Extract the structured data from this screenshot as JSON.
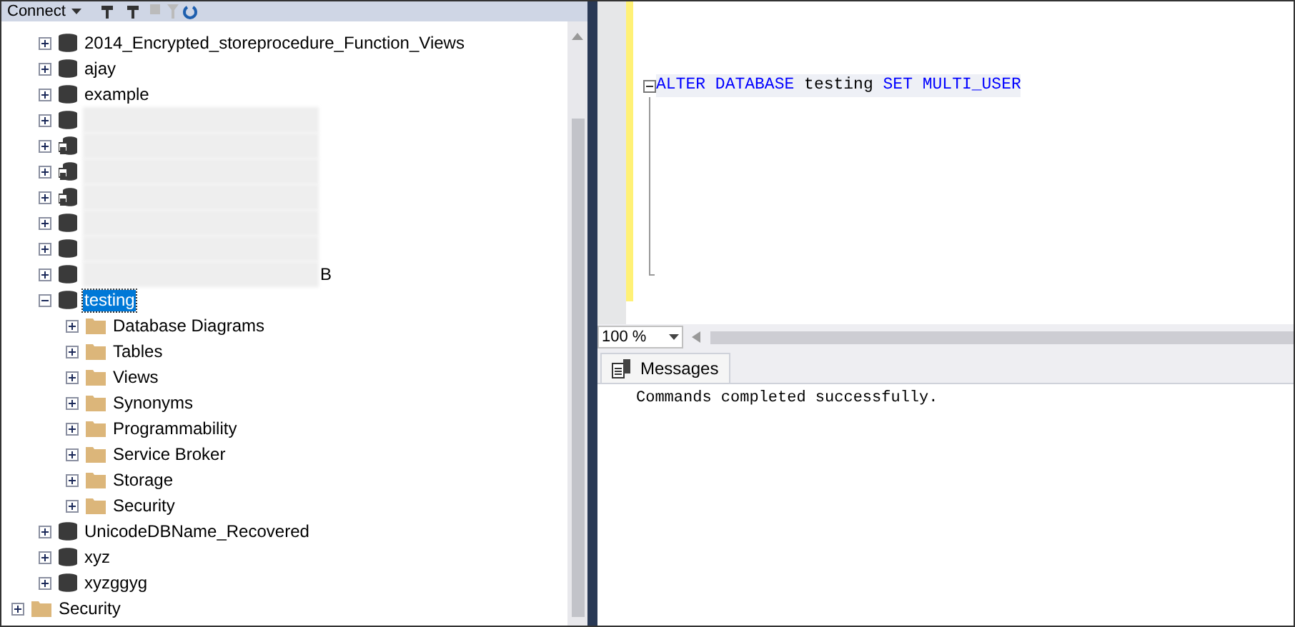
{
  "toolbar": {
    "connect": "Connect"
  },
  "tree": [
    {
      "label": "2014_Encrypted_storeprocedure_Function_Views",
      "kind": "database",
      "expanded": false
    },
    {
      "label": "ajay",
      "kind": "database",
      "expanded": false
    },
    {
      "label": "example",
      "kind": "database",
      "expanded": false
    },
    {
      "kind": "database",
      "expanded": false,
      "redacted": true
    },
    {
      "kind": "snapshot",
      "expanded": false,
      "redacted": true
    },
    {
      "kind": "snapshot",
      "expanded": false,
      "redacted": true
    },
    {
      "kind": "snapshot",
      "expanded": false,
      "redacted": true
    },
    {
      "kind": "database",
      "expanded": false,
      "redacted": true
    },
    {
      "kind": "database",
      "expanded": false,
      "redacted": true
    },
    {
      "label": "B",
      "kind": "database",
      "expanded": false,
      "redacted": true
    },
    {
      "label": "testing",
      "kind": "database",
      "expanded": true,
      "selected": true,
      "children": [
        {
          "label": "Database Diagrams",
          "kind": "folder",
          "expanded": false
        },
        {
          "label": "Tables",
          "kind": "folder",
          "expanded": false
        },
        {
          "label": "Views",
          "kind": "folder",
          "expanded": false
        },
        {
          "label": "Synonyms",
          "kind": "folder",
          "expanded": false
        },
        {
          "label": "Programmability",
          "kind": "folder",
          "expanded": false
        },
        {
          "label": "Service Broker",
          "kind": "folder",
          "expanded": false
        },
        {
          "label": "Storage",
          "kind": "folder",
          "expanded": false
        },
        {
          "label": "Security",
          "kind": "folder",
          "expanded": false
        }
      ]
    },
    {
      "label": "UnicodeDBName_Recovered",
      "kind": "database",
      "expanded": false
    },
    {
      "label": "xyz",
      "kind": "database",
      "expanded": false
    },
    {
      "label": "xyzggyg",
      "kind": "database",
      "expanded": false
    }
  ],
  "root_items": [
    {
      "label": "Security",
      "kind": "folder",
      "expanded": false
    }
  ],
  "editor": {
    "code": [
      {
        "text": "ALTER",
        "kind": "keyword"
      },
      {
        "text": "DATABASE",
        "kind": "keyword"
      },
      {
        "text": "testing",
        "kind": "plain"
      },
      {
        "text": "SET",
        "kind": "keyword"
      },
      {
        "text": "MULTI_USER",
        "kind": "keyword"
      }
    ],
    "zoom": "100 %"
  },
  "results": {
    "tabs": [
      {
        "label": "Messages",
        "selected": true
      }
    ],
    "message": "Commands completed successfully."
  }
}
